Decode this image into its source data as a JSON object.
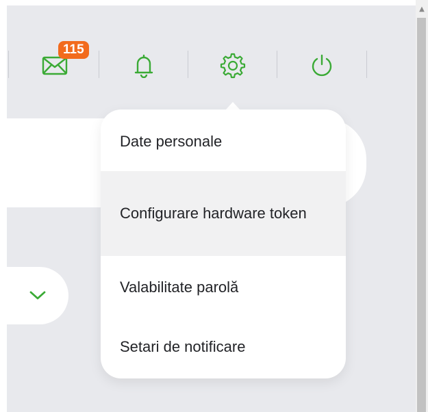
{
  "header": {
    "mail": {
      "icon": "envelope-icon",
      "unread_count": "115",
      "badge_color": "#f26b1d"
    },
    "notifications": {
      "icon": "bell-icon"
    },
    "settings": {
      "icon": "gear-icon"
    },
    "logout": {
      "icon": "power-icon"
    },
    "icon_color": "#3aaa35"
  },
  "settings_menu": {
    "items": [
      {
        "label": "Date personale",
        "active": false
      },
      {
        "label": "Configurare hardware token",
        "active": true
      },
      {
        "label": "Valabilitate parolă",
        "active": false
      },
      {
        "label": "Setari de notificare",
        "active": false
      }
    ]
  },
  "dropdown": {
    "icon": "chevron-down-icon"
  }
}
